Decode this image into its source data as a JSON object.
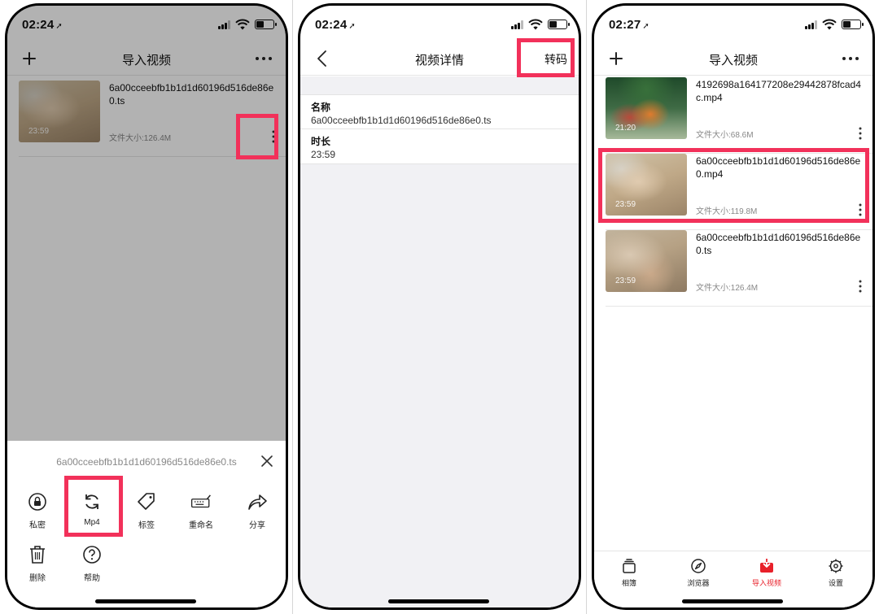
{
  "status": {
    "time1": "02:24",
    "time2": "02:24",
    "time3": "02:27"
  },
  "screen1": {
    "nav_title": "导入视频",
    "video": {
      "name": "6a00cceebfb1b1d1d60196d516de86e0.ts",
      "duration": "23:59",
      "size": "文件大小:126.4M"
    },
    "sheet": {
      "filename": "6a00cceebfb1b1d1d60196d516de86e0.ts",
      "actions": {
        "private": "私密",
        "mp4": "Mp4",
        "tag": "标签",
        "rename": "重命名",
        "share": "分享",
        "delete": "删除",
        "help": "帮助"
      }
    }
  },
  "screen2": {
    "nav_title": "视频详情",
    "transcode_label": "转码",
    "info": [
      {
        "key": "名称",
        "value": "6a00cceebfb1b1d1d60196d516de86e0.ts"
      },
      {
        "key": "时长",
        "value": "23:59"
      }
    ]
  },
  "screen3": {
    "nav_title": "导入视频",
    "videos": [
      {
        "name": "4192698a164177208e29442878fcad4c.mp4",
        "duration": "21:20",
        "size": "文件大小:68.6M"
      },
      {
        "name": "6a00cceebfb1b1d1d60196d516de86e0.mp4",
        "duration": "23:59",
        "size": "文件大小:119.8M"
      },
      {
        "name": "6a00cceebfb1b1d1d60196d516de86e0.ts",
        "duration": "23:59",
        "size": "文件大小:126.4M"
      }
    ],
    "tabs": {
      "album": "相簿",
      "browser": "浏览器",
      "import": "导入视频",
      "settings": "设置"
    }
  },
  "colors": {
    "highlight": "#f2315a",
    "active_tab": "#e8202a"
  }
}
